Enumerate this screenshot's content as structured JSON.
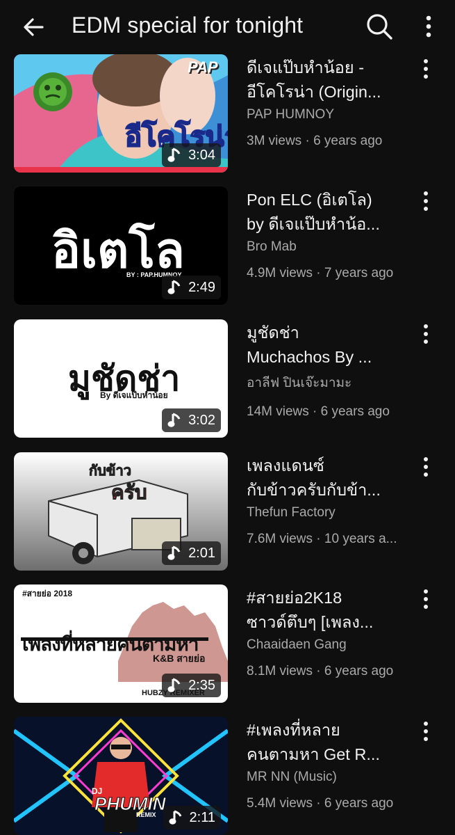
{
  "header": {
    "title": "EDM special for tonight",
    "icons": [
      "back-arrow-icon",
      "search-icon",
      "more-vert-icon"
    ]
  },
  "videos": [
    {
      "title_line1": "ดีเจแป๊บหำน้อย -",
      "title_line2": "อีโคโรน่า (Origin...",
      "channel": "PAP HUMNOY",
      "stats": "3M views · 6 years ago",
      "duration": "3:04",
      "thumb_text": "อีโคโรน่า",
      "thumb_badge": "PAP"
    },
    {
      "title_line1": "Pon ELC (อิเตโล)",
      "title_line2": "by ดีเจแป๊บหำน้อ...",
      "channel": "Bro Mab",
      "stats": "4.9M views · 7 years ago",
      "duration": "2:49",
      "thumb_text": "อิเตโล",
      "thumb_sub": "BY : PAP.HUMNOY"
    },
    {
      "title_line1": "มูชัดช่า",
      "title_line2": "Muchachos By ...",
      "channel": "อาลีฟ ปินเจ๊ะมามะ",
      "stats": "14M views · 6 years ago",
      "duration": "3:02",
      "thumb_text": "มูชัดช่า",
      "thumb_sub": "By ดีเจแป๊บหำน้อย"
    },
    {
      "title_line1": "เพลงแดนซ์",
      "title_line2": "กับข้าวครับกับข้า...",
      "channel": "Thefun Factory",
      "stats": "7.6M views · 10 years a...",
      "duration": "2:01",
      "thumb_text": "กับข้าว",
      "thumb_sub": "ครับ"
    },
    {
      "title_line1": "#สายย่อ2K18",
      "title_line2": "ซาวด์ตึบๆ [เพลง...",
      "channel": "Chaaidaen Gang",
      "stats": "8.1M views · 6 years ago",
      "duration": "2:35",
      "thumb_text": "เพลงที่หลายคนตามหา",
      "thumb_top": "#สายย่อ 2018",
      "thumb_sub": "K&B สายย่อ",
      "thumb_foot": "HUBZY REMIXER"
    },
    {
      "title_line1": "#เพลงที่หลาย",
      "title_line2": "คนตามหา Get R...",
      "channel": "MR NN (Music)",
      "stats": "5.4M views · 6 years ago",
      "duration": "2:11",
      "thumb_text": "PHUMIN",
      "thumb_sub": "DJ",
      "thumb_foot": "REMIX"
    }
  ]
}
